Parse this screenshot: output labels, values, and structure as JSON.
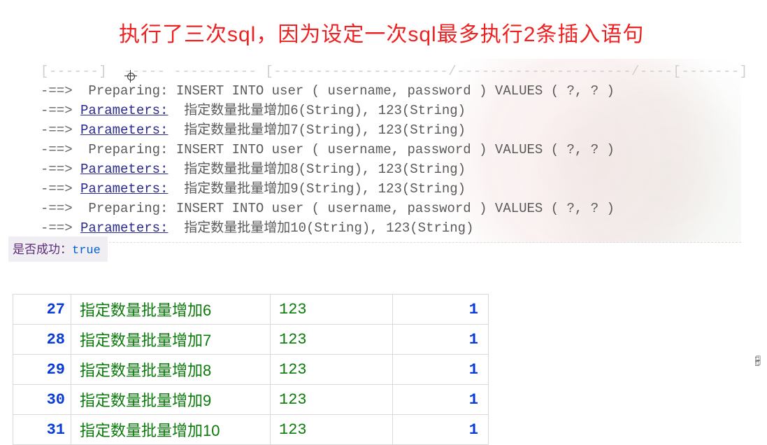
{
  "title": "执行了三次sql，因为设定一次sql最多执行2条插入语句",
  "log": {
    "arrow": "-==>",
    "arrowShort": "-==>",
    "preparing_label": " Preparing:",
    "parameters_label": "Parameters:",
    "insert_sql": "INSERT INTO user ( username, password ) VALUES ( ?, ? )",
    "lines": [
      {
        "type": "prep"
      },
      {
        "type": "param",
        "text": "指定数量批量增加6(String), 123(String)"
      },
      {
        "type": "param",
        "text": "指定数量批量增加7(String), 123(String)"
      },
      {
        "type": "prep"
      },
      {
        "type": "param",
        "text": "指定数量批量增加8(String), 123(String)"
      },
      {
        "type": "param",
        "text": "指定数量批量增加9(String), 123(String)"
      },
      {
        "type": "prep"
      },
      {
        "type": "param",
        "text": "指定数量批量增加10(String), 123(String)"
      }
    ]
  },
  "success": {
    "label": "是否成功：",
    "value": "true"
  },
  "table": {
    "rows": [
      {
        "id": "27",
        "username": "指定数量批量增加6",
        "password": "123",
        "flag": "1"
      },
      {
        "id": "28",
        "username": "指定数量批量增加7",
        "password": "123",
        "flag": "1"
      },
      {
        "id": "29",
        "username": "指定数量批量增加8",
        "password": "123",
        "flag": "1"
      },
      {
        "id": "30",
        "username": "指定数量批量增加9",
        "password": "123",
        "flag": "1"
      },
      {
        "id": "31",
        "username": "指定数量批量增加10",
        "password": "123",
        "flag": "1"
      }
    ]
  }
}
